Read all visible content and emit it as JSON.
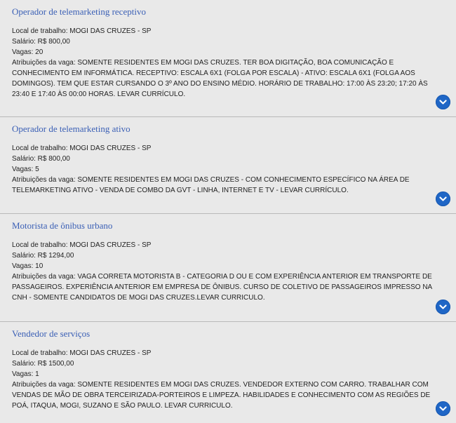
{
  "jobs": [
    {
      "title": "Operador de telemarketing receptivo",
      "local": "Local de trabalho: MOGI DAS CRUZES - SP",
      "salario": "Salário: R$ 800,00",
      "vagas": "Vagas: 20",
      "atribuicoes": "Atribuições da vaga: SOMENTE RESIDENTES EM MOGI DAS CRUZES. TER BOA DIGITAÇÃO, BOA COMUNICAÇÃO E CONHECIMENTO EM INFORMÁTICA. RECEPTIVO: ESCALA 6X1 (FOLGA POR ESCALA) - ATIVO: ESCALA 6X1 (FOLGA AOS DOMINGOS). TEM QUE ESTAR CURSANDO O 3º ANO DO ENSINO MÉDIO. HORÁRIO DE TRABALHO: 17:00 ÀS 23:20; 17:20 ÀS 23:40 E 17:40 ÀS 00:00 HORAS. LEVAR CURRÍCULO."
    },
    {
      "title": "Operador de telemarketing ativo",
      "local": "Local de trabalho: MOGI DAS CRUZES - SP",
      "salario": "Salário: R$ 800,00",
      "vagas": "Vagas: 5",
      "atribuicoes": "Atribuições da vaga: SOMENTE RESIDENTES EM MOGI DAS CRUZES - COM CONHECIMENTO ESPECÍFICO NA ÁREA DE TELEMARKETING ATIVO - VENDA DE COMBO DA GVT - LINHA, INTERNET E TV - LEVAR CURRÍCULO."
    },
    {
      "title": "Motorista de ônibus urbano",
      "local": "Local de trabalho: MOGI DAS CRUZES - SP",
      "salario": "Salário: R$ 1294,00",
      "vagas": "Vagas: 10",
      "atribuicoes": "Atribuições da vaga: VAGA CORRETA MOTORISTA B - CATEGORIA D OU E COM EXPERIÊNCIA ANTERIOR EM TRANSPORTE DE PASSAGEIROS. EXPERIÊNCIA ANTERIOR EM EMPRESA DE ÔNIBUS. CURSO DE COLETIVO DE PASSAGEIROS IMPRESSO NA CNH - SOMENTE CANDIDATOS DE MOGI DAS CRUZES.LEVAR CURRICULO."
    },
    {
      "title": "Vendedor de serviços",
      "local": "Local de trabalho: MOGI DAS CRUZES - SP",
      "salario": "Salário: R$ 1500,00",
      "vagas": "Vagas: 1",
      "atribuicoes": "Atribuições da vaga: SOMENTE RESIDENTES EM MOGI DAS CRUZES. VENDEDOR EXTERNO COM CARRO. TRABALHAR COM VENDAS DE MÃO DE OBRA TERCEIRIZADA-PORTEIROS E LIMPEZA. HABILIDADES E CONHECIMENTO COM AS REGIÕES DE POÁ, ITAQUA, MOGI, SUZANO E SÃO PAULO. LEVAR CURRICULO."
    }
  ],
  "icons": {
    "expand": "chevron-down-icon"
  },
  "colors": {
    "title": "#3a5fb5",
    "expand_button": "#1f66c6",
    "background": "#e9e9e9"
  }
}
